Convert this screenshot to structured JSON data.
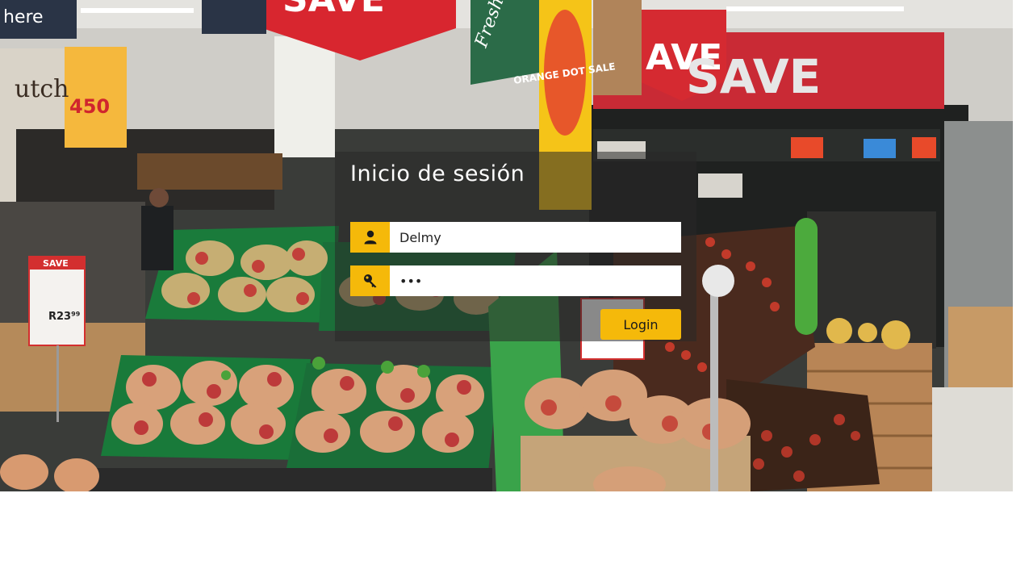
{
  "background": {
    "signs": {
      "save_top": "SAVE",
      "save_right_1": "AVE",
      "save_right_2": "SAVE",
      "orange_dot_sale": "ORANGE DOT SALE",
      "price_small": "450",
      "price_tag_save": "SAVE",
      "price_tag_value": "R23⁹⁹",
      "top_left_sign": "here",
      "left_wall_text": "utch",
      "fresh_sign": "Fresh"
    }
  },
  "login": {
    "title": "Inicio de sesión",
    "username": {
      "value": "Delmy",
      "icon": "user-icon"
    },
    "password": {
      "value": "•••",
      "icon": "key-icon"
    },
    "button_label": "Login"
  },
  "colors": {
    "accent": "#f5b90a",
    "panel_overlay": "rgba(40,40,40,0.55)",
    "save_red": "#d8262f"
  }
}
